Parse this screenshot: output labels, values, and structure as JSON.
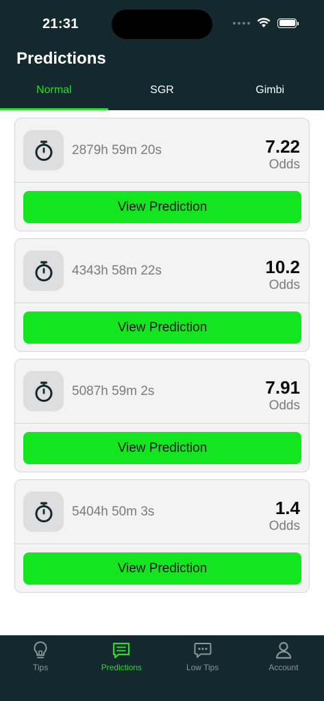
{
  "status_bar": {
    "time": "21:31"
  },
  "header": {
    "title": "Predictions"
  },
  "tabs": [
    {
      "label": "Normal",
      "active": true
    },
    {
      "label": "SGR",
      "active": false
    },
    {
      "label": "Gimbi",
      "active": false
    }
  ],
  "cards": [
    {
      "countdown": "2879h 59m 20s",
      "odds": "7.22",
      "odds_label": "Odds",
      "button_label": "View Prediction"
    },
    {
      "countdown": "4343h 58m 22s",
      "odds": "10.2",
      "odds_label": "Odds",
      "button_label": "View Prediction"
    },
    {
      "countdown": "5087h 59m 2s",
      "odds": "7.91",
      "odds_label": "Odds",
      "button_label": "View Prediction"
    },
    {
      "countdown": "5404h 50m 3s",
      "odds": "1.4",
      "odds_label": "Odds",
      "button_label": "View Prediction"
    }
  ],
  "bottom_nav": [
    {
      "label": "Tips",
      "icon": "lightbulb-icon",
      "active": false
    },
    {
      "label": "Predictions",
      "icon": "list-message-icon",
      "active": true
    },
    {
      "label": "Low Tips",
      "icon": "chat-bubble-icon",
      "active": false
    },
    {
      "label": "Account",
      "icon": "person-icon",
      "active": false
    }
  ],
  "colors": {
    "header_bg": "#13292e",
    "accent": "#2bdc2b",
    "button_green": "#13e61f",
    "card_bg": "#f3f3f3"
  }
}
